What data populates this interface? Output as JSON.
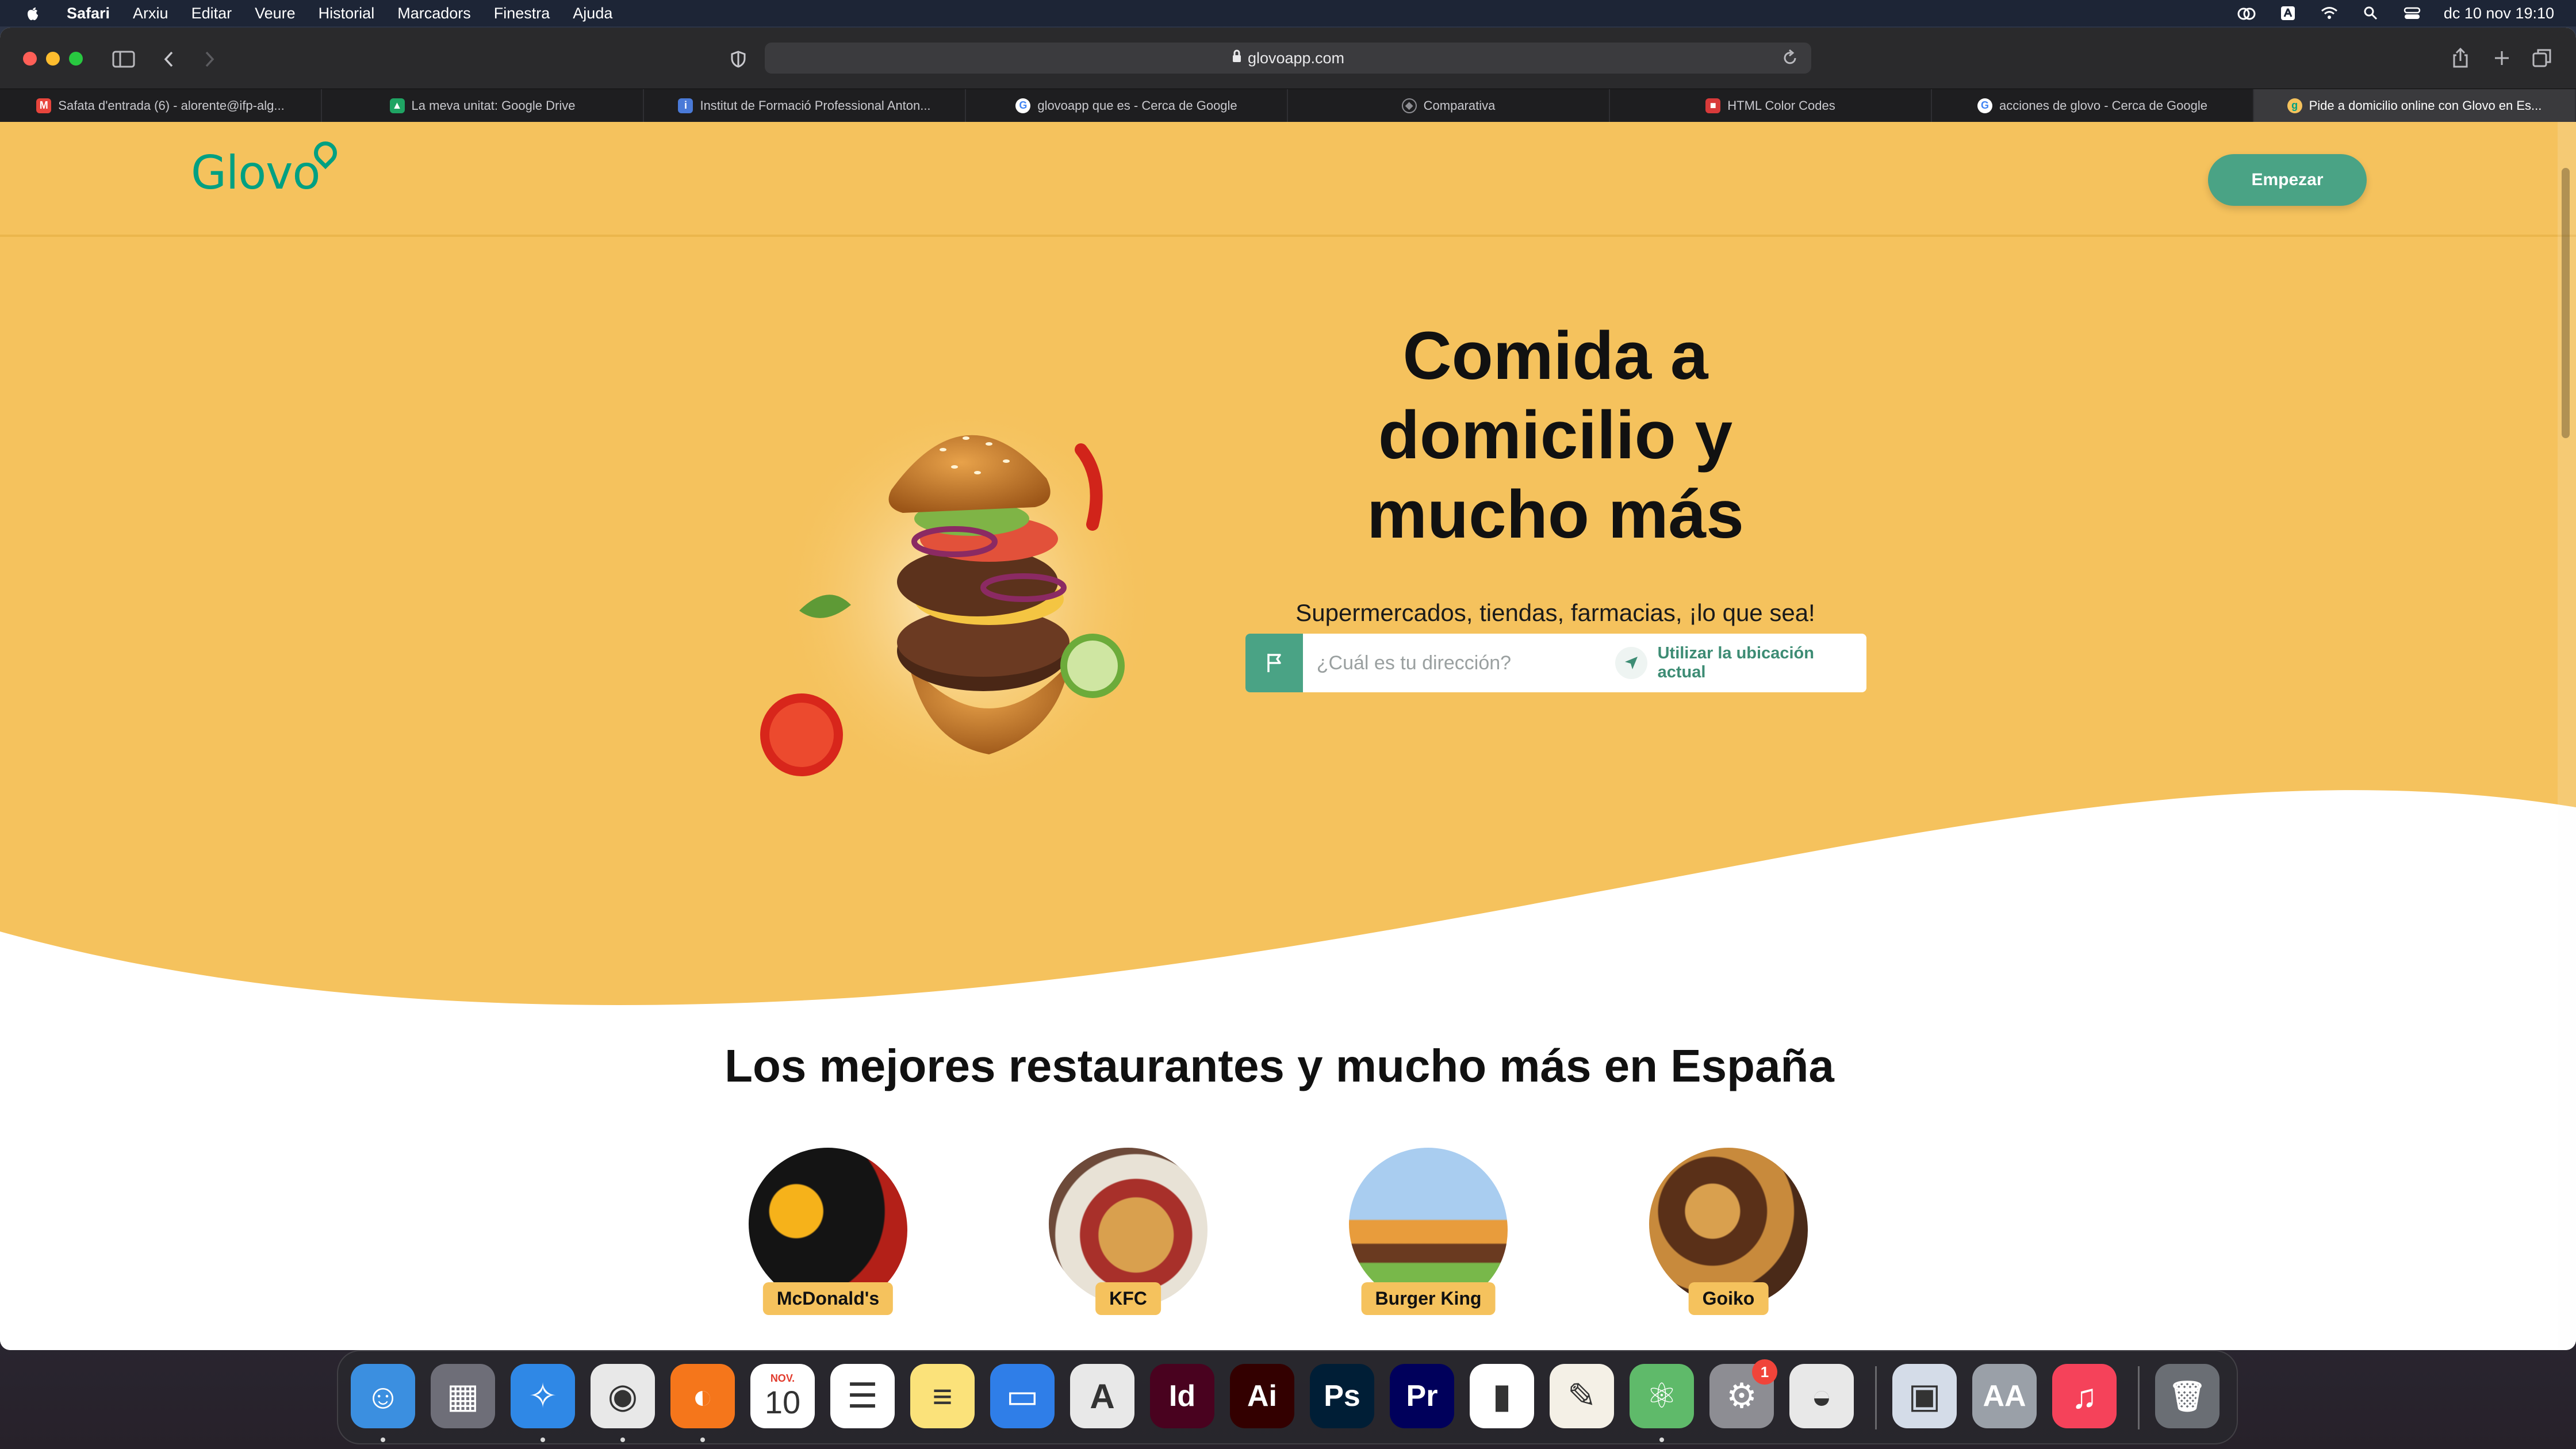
{
  "menubar": {
    "app_name": "Safari",
    "items": [
      "Arxiu",
      "Editar",
      "Veure",
      "Historial",
      "Marcadors",
      "Finestra",
      "Ajuda"
    ],
    "clock": "dc 10 nov  19:10",
    "status_icons": [
      "creative-cloud-icon",
      "bluetooth-icon",
      "wifi-icon",
      "spotlight-icon",
      "control-center-icon"
    ]
  },
  "browser": {
    "url": "glovoapp.com",
    "tabs": [
      {
        "label": "Safata d'entrada (6) - alorente@ifp-alg...",
        "favicon": "gmail-icon",
        "color": "#e8453c"
      },
      {
        "label": "La meva unitat: Google Drive",
        "favicon": "google-drive-icon",
        "color": "#1fa463"
      },
      {
        "label": "Institut de Formació Professional Anton...",
        "favicon": "institut-icon",
        "color": "#4a7ad8"
      },
      {
        "label": "glovoapp que es - Cerca de Google",
        "favicon": "google-icon",
        "color": "#4285f4"
      },
      {
        "label": "Comparativa",
        "favicon": "compass-icon",
        "color": "#8e8e93"
      },
      {
        "label": "HTML Color Codes",
        "favicon": "html-color-codes-icon",
        "color": "#d83a3a"
      },
      {
        "label": "acciones de glovo - Cerca de Google",
        "favicon": "google-icon",
        "color": "#4285f4"
      },
      {
        "label": "Pide a domicilio online con Glovo en Es...",
        "favicon": "glovo-icon",
        "color": "#f5c25d"
      }
    ],
    "active_tab": 7
  },
  "page": {
    "logo_text": "Glovo",
    "start_button": "Empezar",
    "hero_title": "Comida a domicilio y mucho más",
    "hero_subtitle": "Supermercados, tiendas, farmacias, ¡lo que sea!",
    "address_placeholder": "¿Cuál es tu dirección?",
    "location_button": "Utilizar la ubicación actual",
    "section_title": "Los mejores restaurantes y mucho más en España",
    "restaurants": [
      {
        "name": "McDonald's",
        "photo_color": "#b32018"
      },
      {
        "name": "KFC",
        "photo_color": "#c8943c"
      },
      {
        "name": "Burger King",
        "photo_color": "#7aa6d6"
      },
      {
        "name": "Goiko",
        "photo_color": "#7a4a2a"
      }
    ],
    "colors": {
      "brand_yellow": "#f5c25d",
      "brand_green": "#00a082",
      "button_green": "#4aa385"
    }
  },
  "dock": {
    "apps": [
      {
        "name": "finder-icon",
        "color": "#3b8fe0",
        "glyph": "☺",
        "running": true
      },
      {
        "name": "launchpad-icon",
        "color": "#6e6e78",
        "glyph": "▦",
        "running": false
      },
      {
        "name": "safari-icon",
        "color": "#2f88e6",
        "glyph": "✧",
        "running": true
      },
      {
        "name": "chrome-icon",
        "color": "#e8e8e8",
        "glyph": "◉",
        "running": true
      },
      {
        "name": "firefox-icon",
        "color": "#f5761b",
        "glyph": "◐",
        "running": true
      },
      {
        "name": "calendar-icon",
        "color": "#ffffff",
        "glyph": "10",
        "running": false
      },
      {
        "name": "reminders-icon",
        "color": "#ffffff",
        "glyph": "☰",
        "running": false
      },
      {
        "name": "notes-icon",
        "color": "#fbe27a",
        "glyph": "≡",
        "running": false
      },
      {
        "name": "keynote-icon",
        "color": "#2f7ee8",
        "glyph": "▭",
        "running": false
      },
      {
        "name": "acrobat-icon",
        "color": "#e8e8e8",
        "glyph": "A",
        "running": false
      },
      {
        "name": "indesign-icon",
        "color": "#49021f",
        "glyph": "Id",
        "running": false
      },
      {
        "name": "illustrator-icon",
        "color": "#330000",
        "glyph": "Ai",
        "running": false
      },
      {
        "name": "photoshop-icon",
        "color": "#001e36",
        "glyph": "Ps",
        "running": false
      },
      {
        "name": "premiere-icon",
        "color": "#00005b",
        "glyph": "Pr",
        "running": false
      },
      {
        "name": "numbers-icon",
        "color": "#ffffff",
        "glyph": "▮",
        "running": false
      },
      {
        "name": "pages-icon",
        "color": "#f4f0e6",
        "glyph": "✎",
        "running": false
      },
      {
        "name": "atom-icon",
        "color": "#5fba6a",
        "glyph": "⚛",
        "running": true
      },
      {
        "name": "system-preferences-icon",
        "color": "#8d8d93",
        "glyph": "⚙",
        "running": false,
        "badge": "1"
      },
      {
        "name": "sequel-pro-icon",
        "color": "#e8e8e8",
        "glyph": "◒",
        "running": false
      },
      {
        "name": "preview-icon",
        "color": "#d4dce8",
        "glyph": "▣",
        "running": false
      },
      {
        "name": "font-book-icon",
        "color": "#9aa0a8",
        "glyph": "AA",
        "running": false
      },
      {
        "name": "music-icon",
        "color": "#f5425a",
        "glyph": "♫",
        "running": false
      },
      {
        "name": "trash-icon",
        "color": "#6a6e74",
        "glyph": "🗑",
        "running": false
      }
    ],
    "calendar_month": "NOV."
  }
}
